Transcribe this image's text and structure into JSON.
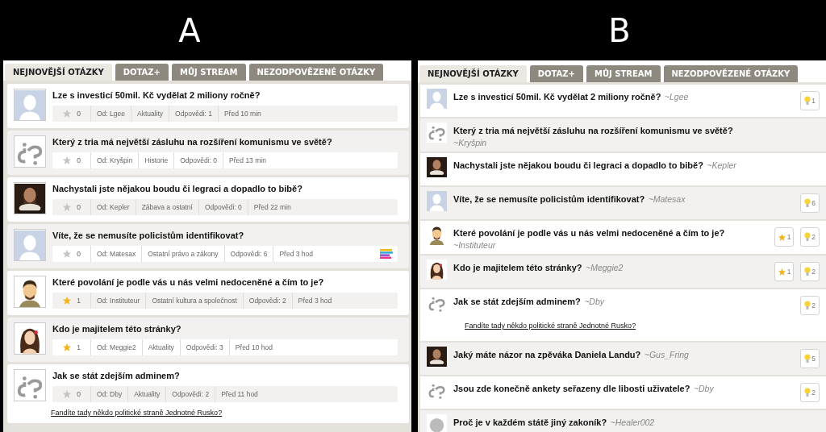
{
  "header": {
    "left_label": "A",
    "right_label": "B"
  },
  "variant_a": {
    "tabs": [
      {
        "label": "NEJNOVĚJŠÍ OTÁZKY",
        "selected": true
      },
      {
        "label": "DOTAZ+",
        "selected": false
      },
      {
        "label": "MŮJ STREAM",
        "selected": false
      },
      {
        "label": "NEZODPOVĚZENÉ OTÁZKY",
        "selected": false
      }
    ],
    "questions": [
      {
        "title": "Lze s investicí 50mil. Kč vydělat 2 miliony ročně?",
        "avatar": {
          "kind": "silhouette"
        },
        "starred": false,
        "star_count": "0",
        "author": "Od: Lgee",
        "category": "Aktuality",
        "answers": "Odpovědi: 1",
        "time": "Před 10 min",
        "poll": false
      },
      {
        "title": "Který z tria má největší zásluhu na rozšíření komunismu ve světě?",
        "avatar": {
          "kind": "logo"
        },
        "starred": false,
        "star_count": "0",
        "author": "Od: Kryšpin",
        "category": "Historie",
        "answers": "Odpovědi: 0",
        "time": "Před 13 min",
        "poll": false
      },
      {
        "title": "Nachystali jste nějakou boudu či legraci a dopadlo to bibě?",
        "starred": false,
        "star_count": "0",
        "author": "Od: Kepler",
        "category": "Zábava a ostatní",
        "answers": "Odpovědi: 0",
        "time": "Před 22 min",
        "poll": false
      },
      {
        "title": "Víte, že se nemusíte policistům identifikovat?",
        "avatar": {
          "kind": "silhouette"
        },
        "starred": false,
        "star_count": "0",
        "author": "Od: Matesax",
        "category": "Ostatní právo a zákony",
        "answers": "Odpovědi: 6",
        "time": "Před 3 hod",
        "poll": true
      },
      {
        "title": "Které povolání je podle vás u nás velmi nedoceněné a čím to je?",
        "avatar": {
          "kind": "man"
        },
        "starred": true,
        "star_count": "1",
        "author": "Od: Instituteur",
        "category": "Ostatní kultura a společnost",
        "answers": "Odpovědi: 2",
        "time": "Před 3 hod",
        "poll": false
      },
      {
        "title": "Kdo je majitelem této stránky?",
        "avatar": {
          "kind": "woman"
        },
        "starred": true,
        "star_count": "1",
        "author": "Od: Meggie2",
        "category": "Aktuality",
        "answers": "Odpovědi: 3",
        "time": "Před 10 hod",
        "poll": false
      },
      {
        "title": "Jak se stát zdejším adminem?",
        "avatar": {
          "kind": "logo"
        },
        "starred": false,
        "star_count": "0",
        "author": "Od: Dby",
        "category": "Aktuality",
        "answers": "Odpovědi: 2",
        "time": "Před 11 hod",
        "poll": false,
        "link": "Fandíte tady někdo politické straně Jednotné Rusko?"
      }
    ]
  },
  "variant_b": {
    "tabs": [
      {
        "label": "NEJNOVĚJŠÍ OTÁZKY",
        "selected": true
      },
      {
        "label": "DOTAZ+",
        "selected": false
      },
      {
        "label": "MŮJ STREAM",
        "selected": false
      },
      {
        "label": "NEZODPOVĚZENÉ OTÁZKY",
        "selected": false
      }
    ],
    "questions": [
      {
        "title": "Lze s investicí 50mil. Kč vydělat 2 miliony ročně?",
        "author": "~Lgee",
        "avatar": {
          "kind": "silhouette"
        },
        "bulbs": "1"
      },
      {
        "title": "Který z tria má největší zásluhu na rozšíření komunismu ve světě?",
        "author": "~Kryšpin",
        "avatar": {
          "kind": "logo"
        }
      },
      {
        "title": "Nachystali jste nějakou boudu či legraci a dopadlo to bibě?",
        "author": "~Kepler"
      },
      {
        "title": "Víte, že se nemusíte policistům identifikovat?",
        "author": "~Matesax",
        "avatar": {
          "kind": "silhouette"
        },
        "bulbs": "6"
      },
      {
        "title": "Které povolání je podle vás u nás velmi nedoceněné a čím to je?",
        "author": "~Instituteur",
        "avatar": {
          "kind": "man"
        },
        "stars_badge": "1",
        "bulbs": "2"
      },
      {
        "title": "Kdo je majitelem této stránky?",
        "author": "~Meggie2",
        "avatar": {
          "kind": "woman"
        },
        "stars_badge": "1",
        "bulbs": "2"
      },
      {
        "title": "Jak se stát zdejším adminem?",
        "author": "~Dby",
        "avatar": {
          "kind": "logo"
        },
        "bulbs": "2",
        "link": "Fandíte tady někdo politické straně Jednotné Rusko?"
      },
      {
        "title": "Jaký máte názor na zpěváka Daniela Landu?",
        "author": "~Gus_Fring",
        "bulbs": "5"
      },
      {
        "title": "Jsou zde konečně ankety seřazeny dle libosti uživatele?",
        "author": "~Dby",
        "avatar": {
          "kind": "logo"
        },
        "bulbs": "2"
      },
      {
        "title": "Proč je v každém státě jiný zakoník?",
        "author": "~Healer002",
        "avatar": {
          "kind": "circle"
        }
      }
    ]
  }
}
